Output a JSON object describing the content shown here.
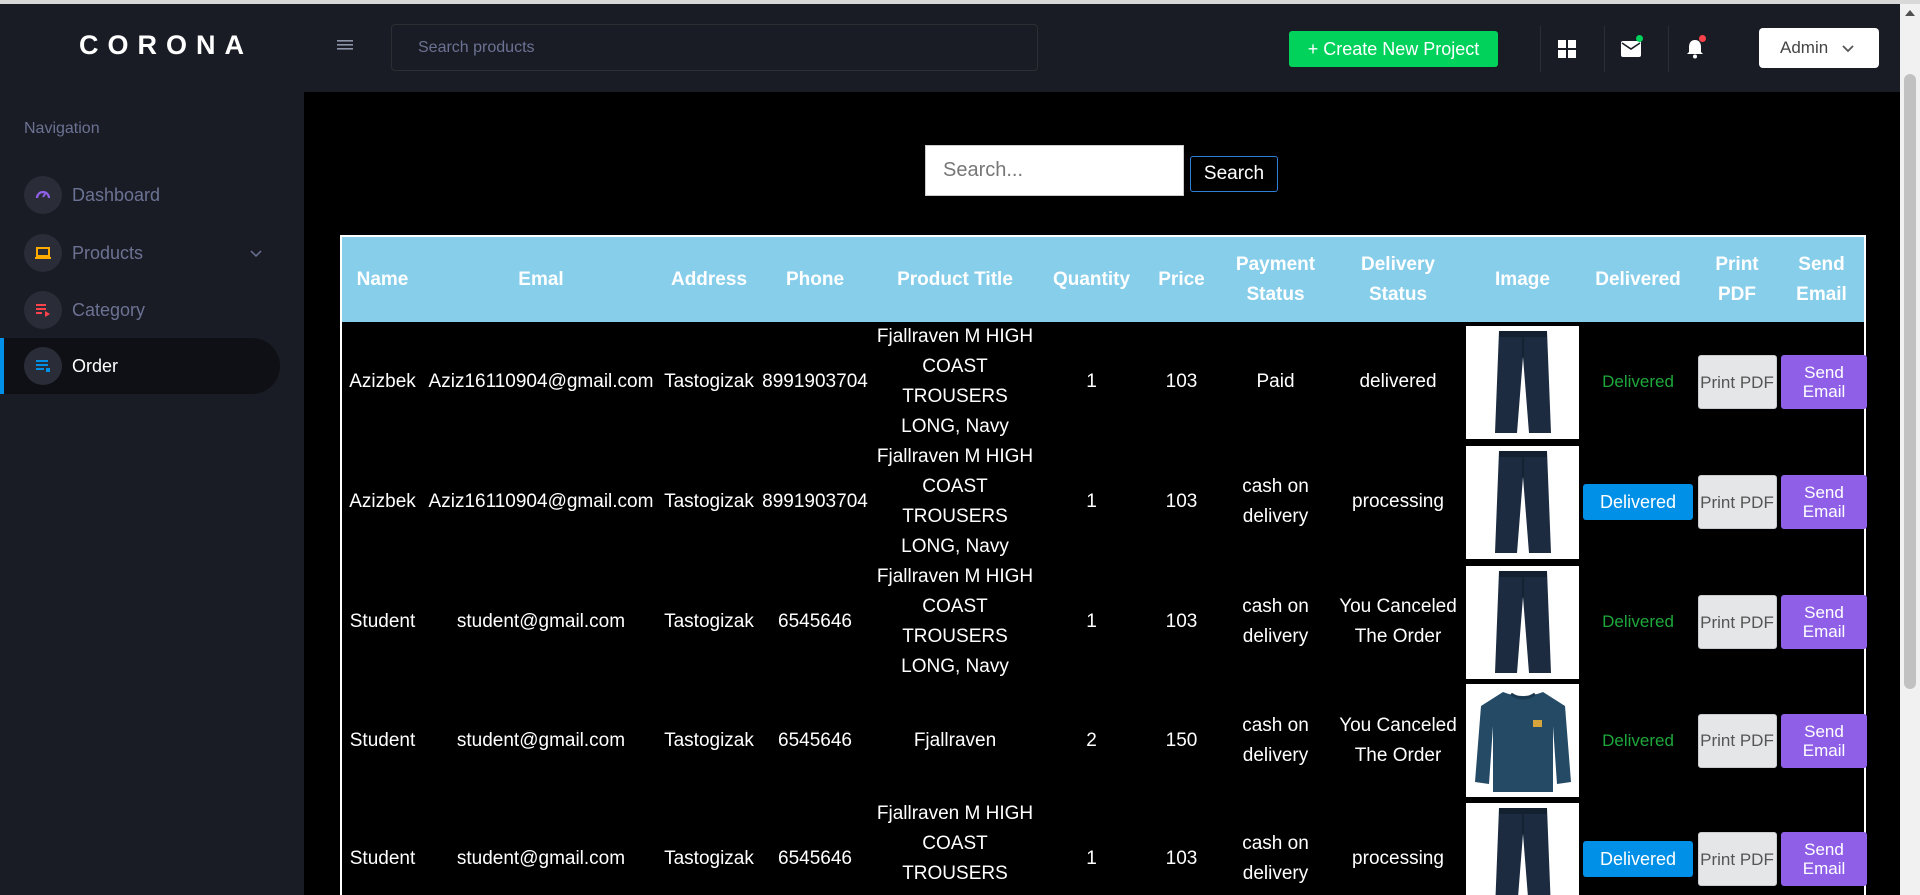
{
  "brand": "CORONA",
  "sidebar": {
    "heading": "Navigation",
    "items": [
      {
        "label": "Dashboard",
        "icon": "speedometer-icon",
        "color": "#8f5fe8"
      },
      {
        "label": "Products",
        "icon": "laptop-icon",
        "color": "#ffab00"
      },
      {
        "label": "Category",
        "icon": "playlist-play-icon",
        "color": "#fc424a"
      },
      {
        "label": "Order",
        "icon": "table-icon",
        "color": "#0090e7",
        "active": true
      }
    ]
  },
  "navbar": {
    "search_placeholder": "Search products",
    "create_button": "+ Create New Project",
    "admin_label": "Admin",
    "colors": {
      "create": "#00d25b",
      "mail_dot": "#00d25b",
      "bell_dot": "#fc424a"
    }
  },
  "search": {
    "placeholder": "Search...",
    "button": "Search"
  },
  "table": {
    "headers": [
      "Name",
      "Emal",
      "Address",
      "Phone",
      "Product Title",
      "Quantity",
      "Price",
      "Payment Status",
      "Delivery Status",
      "Image",
      "Delivered",
      "Print PDF",
      "Send Email"
    ],
    "rows": [
      {
        "name": "Azizbek",
        "email": "Aziz16110904@gmail.com",
        "address": "Tastogizak",
        "phone": "8991903704",
        "product_title": "Fjallraven M HIGH COAST TROUSERS LONG, Navy",
        "quantity": "1",
        "price": "103",
        "payment_status": "Paid",
        "delivery_status": "delivered",
        "image": "navy-trousers",
        "delivered": "Delivered",
        "delivered_is_button": false,
        "print_pdf": "Print PDF",
        "send_email": "Send Email"
      },
      {
        "name": "Azizbek",
        "email": "Aziz16110904@gmail.com",
        "address": "Tastogizak",
        "phone": "8991903704",
        "product_title": "Fjallraven M HIGH COAST TROUSERS LONG, Navy",
        "quantity": "1",
        "price": "103",
        "payment_status": "cash on delivery",
        "delivery_status": "processing",
        "image": "navy-trousers",
        "delivered": "Delivered",
        "delivered_is_button": true,
        "print_pdf": "Print PDF",
        "send_email": "Send Email"
      },
      {
        "name": "Student",
        "email": "student@gmail.com",
        "address": "Tastogizak",
        "phone": "6545646",
        "product_title": "Fjallraven M HIGH COAST TROUSERS LONG, Navy",
        "quantity": "1",
        "price": "103",
        "payment_status": "cash on delivery",
        "delivery_status": "You Canceled The Order",
        "image": "navy-trousers",
        "delivered": "Delivered",
        "delivered_is_button": false,
        "print_pdf": "Print PDF",
        "send_email": "Send Email"
      },
      {
        "name": "Student",
        "email": "student@gmail.com",
        "address": "Tastogizak",
        "phone": "6545646",
        "product_title": "Fjallraven",
        "quantity": "2",
        "price": "150",
        "payment_status": "cash on delivery",
        "delivery_status": "You Canceled The Order",
        "image": "navy-sweater",
        "delivered": "Delivered",
        "delivered_is_button": false,
        "print_pdf": "Print PDF",
        "send_email": "Send Email"
      },
      {
        "name": "Student",
        "email": "student@gmail.com",
        "address": "Tastogizak",
        "phone": "6545646",
        "product_title": "Fjallraven M HIGH COAST TROUSERS LONG, Navy",
        "quantity": "1",
        "price": "103",
        "payment_status": "cash on delivery",
        "delivery_status": "processing",
        "image": "navy-trousers",
        "delivered": "Delivered",
        "delivered_is_button": true,
        "print_pdf": "Print PDF",
        "send_email": "Send Email"
      }
    ]
  }
}
